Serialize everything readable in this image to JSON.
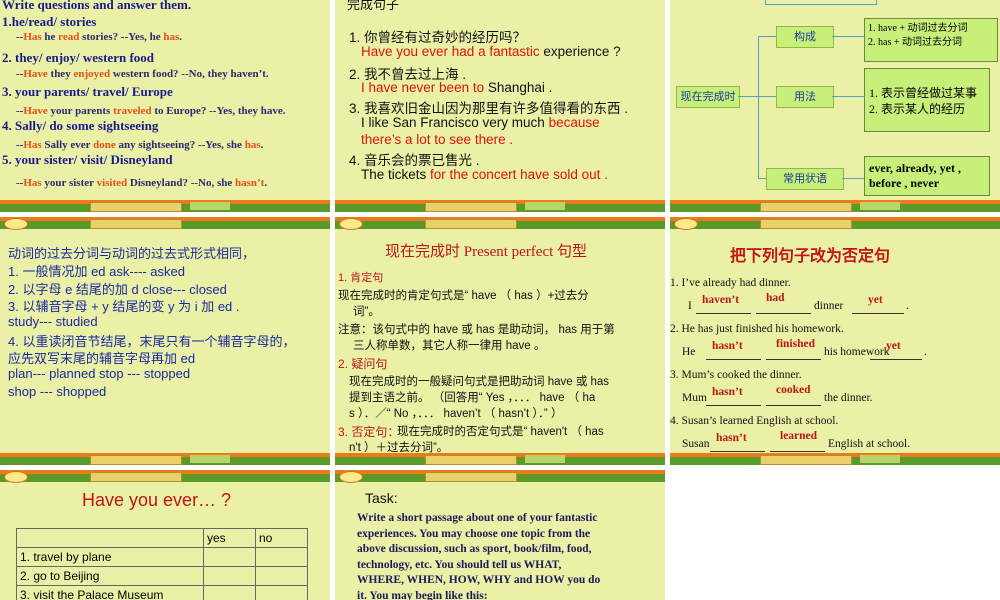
{
  "s1": {
    "heading": "Write questions and answer them.",
    "items": [
      {
        "num": "1.",
        "prompt": "he/read/ stories",
        "a": "--",
        "b": "Has",
        "c": " he ",
        "d": "read",
        "e": " stories?  --Yes, he ",
        "f": "has",
        "g": "."
      },
      {
        "num": "2.",
        "prompt": " they/ enjoy/ western food",
        "a": "--",
        "b": "Have",
        "c": " they ",
        "d": "enjoyed",
        "e": " western food?  --No, they haven’t.",
        "f": "",
        "g": ""
      },
      {
        "num": "3.",
        "prompt": " your parents/ travel/ Europe",
        "a": "--",
        "b": "Have",
        "c": " your parents ",
        "d": "traveled",
        "e": " to Europe?  --Yes, they have.",
        "f": "",
        "g": ""
      },
      {
        "num": "4.",
        "prompt": " Sally/ do some sightseeing",
        "a": "--",
        "b": "Has",
        "c": " Sally ever ",
        "d": "done",
        "e": " any sightseeing?  --Yes, she ",
        "f": "has",
        "g": "."
      },
      {
        "num": "5.",
        "prompt": " your sister/ visit/ Disneyland",
        "a": "--",
        "b": "Has",
        "c": " your sister ",
        "d": "visited",
        "e": " Disneyland?  --No, she ",
        "f": "hasn’t",
        "g": "."
      }
    ]
  },
  "s2": {
    "top": "完成句子",
    "lines": [
      {
        "cn": "1. 你曾经有过奇妙的经历吗？"
      },
      {
        "red": "Have you ever had a fantastic",
        "blk": " experience ?"
      },
      {
        "cn": "2. 我不曾去过上海 ."
      },
      {
        "red": "I have never been to",
        "blk": " Shanghai ."
      },
      {
        "cn": "3. 我喜欢旧金山因为那里有许多值得看的东西 ."
      },
      {
        "blk": "I like San Francisco very much ",
        "red": "because"
      },
      {
        "red": "there’s a lot to see there ."
      },
      {
        "cn": "4. 音乐会的票已售光 ."
      },
      {
        "blk": "The tickets ",
        "red": "for the concert have sold out ."
      }
    ]
  },
  "s3": {
    "root": "现在完成时",
    "branch1": "构成",
    "branch2": "用法",
    "branch3": "常用状语",
    "goucheng": [
      "1. have + 动词过去分词",
      "2. has + 动词过去分词"
    ],
    "yongfa": [
      "1. 表示曾经做过某事",
      "2. 表示某人的经历"
    ],
    "zhuangyu": [
      "ever, already, yet ,",
      "before , never"
    ]
  },
  "s4": {
    "lines": [
      "动词的过去分词与动词的过去式形式相同，",
      "1. 一般情况加 ed   ask---- asked",
      "2. 以字母 e  结尾的加 d   close--- closed",
      "3.  以辅音字母 + y 结尾的变 y 为 i  加 ed .",
      "     study--- studied",
      "4. 以重读闭音节结尾，末尾只有一个辅音字母的，",
      "         应先双写末尾的辅音字母再加 ed",
      "     plan--- planned  stop --- stopped",
      "     shop --- shopped"
    ]
  },
  "s5": {
    "title": "现在完成时  Present perfect  句型",
    "h1": "1. 肯定句",
    "p1a": "现在完成时的肯定句式是“ have （ has ）+过去分",
    "p1b": "词”。",
    "p2a": "注意：该句式中的 have 或 has 是助动词， has 用于第",
    "p2b": "三人称单数，其它人称一律用 have 。",
    "h2": "2. 疑问句",
    "p3a": "    现在完成时的一般疑问句式是把助动词 have 或 has",
    "p3b": "提到主语之前。  （回答用“ Yes ，．．． have （ ha",
    "p3c": "s ）．／“ No ，．．．  haven’t （ hasn’t ）．” ）",
    "h3": "3. 否定句：",
    "p4a": "现在完成时的否定句式是“ haven't （ has",
    "p4b": "n't ）＋过去分词”。"
  },
  "s6": {
    "title": "把下列句子改为否定句",
    "q": [
      {
        "src": "1.  I’ve already had dinner.",
        "pre": "I",
        "a1": "haven’t",
        "a2": "had",
        "mid": "dinner",
        "a3": "yet",
        "end": "."
      },
      {
        "src": "2. He has just finished his homework.",
        "pre": "He",
        "a1": "hasn’t",
        "a2": "finished",
        "mid": "his homework",
        "a3": "yet",
        "end": "."
      },
      {
        "src": "3. Mum’s cooked the dinner.",
        "pre": "Mum",
        "a1": "hasn’t",
        "a2": "cooked",
        "mid": "the dinner.",
        "a3": "",
        "end": ""
      },
      {
        "src": "4. Susan’s learned English at school.",
        "pre": "Susan",
        "a1": "hasn’t",
        "a2": "learned",
        "mid": "English at school.",
        "a3": "",
        "end": ""
      }
    ]
  },
  "s7": {
    "title": "Have you ever… ?",
    "cols": [
      "",
      "yes",
      "no"
    ],
    "rows": [
      "1. travel by plane",
      "2. go to Beijing",
      "3. visit the Palace Museum"
    ]
  },
  "s8": {
    "title": "Task:",
    "body": [
      "Write a short passage about one of your fantastic",
      "experiences. You may choose one topic from the",
      "above discussion, such as sport, book/film, food,",
      "technology, etc. You should tell us WHAT,",
      "WHERE, WHEN, HOW, WHY and HOW you do",
      "it. You may begin like this:"
    ]
  }
}
